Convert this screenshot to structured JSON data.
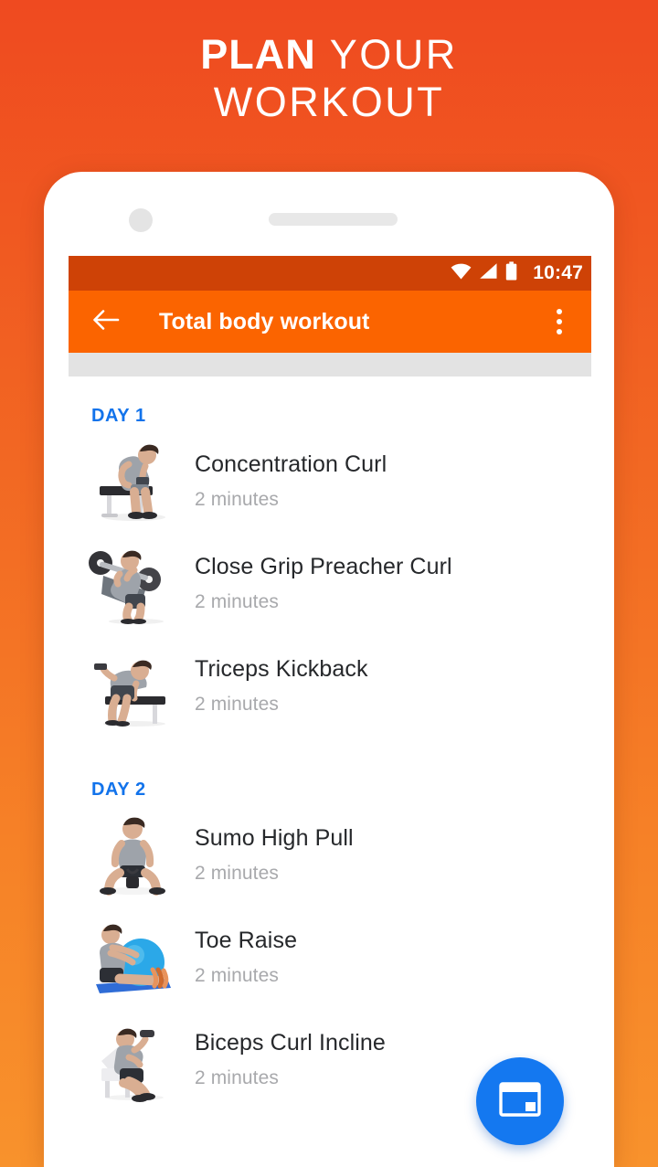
{
  "promo": {
    "headline_line1_strong": "PLAN",
    "headline_line1_light": "YOUR",
    "headline_line2": "WORKOUT",
    "background_top_color": "#EF4A20",
    "background_bottom_color": "#F8922C"
  },
  "phone": {
    "camera_icon": "camera-dot",
    "speaker_icon": "earpiece-speaker"
  },
  "status_bar": {
    "time": "10:47",
    "wifi_icon": "wifi-icon",
    "signal_icon": "cellular-signal-icon",
    "battery_icon": "battery-icon",
    "background_color": "#CE4206"
  },
  "app_bar": {
    "back_icon": "arrow-left-icon",
    "title": "Total body workout",
    "overflow_icon": "more-vertical-icon",
    "background_color": "#FB6400"
  },
  "workout": {
    "day_color": "#1273EB",
    "days": [
      {
        "label": "DAY 1",
        "exercises": [
          {
            "name": "Concentration Curl",
            "duration": "2 minutes",
            "thumb": "concentration-curl-thumbnail"
          },
          {
            "name": "Close Grip Preacher Curl",
            "duration": "2 minutes",
            "thumb": "close-grip-preacher-curl-thumbnail"
          },
          {
            "name": "Triceps Kickback",
            "duration": "2 minutes",
            "thumb": "triceps-kickback-thumbnail"
          }
        ]
      },
      {
        "label": "DAY 2",
        "exercises": [
          {
            "name": "Sumo High Pull",
            "duration": "2 minutes",
            "thumb": "sumo-high-pull-thumbnail"
          },
          {
            "name": "Toe Raise",
            "duration": "2 minutes",
            "thumb": "toe-raise-thumbnail"
          },
          {
            "name": "Biceps Curl Incline",
            "duration": "2 minutes",
            "thumb": "biceps-curl-incline-thumbnail"
          }
        ]
      }
    ]
  },
  "fab": {
    "icon": "window-card-icon",
    "color": "#1478F0"
  }
}
